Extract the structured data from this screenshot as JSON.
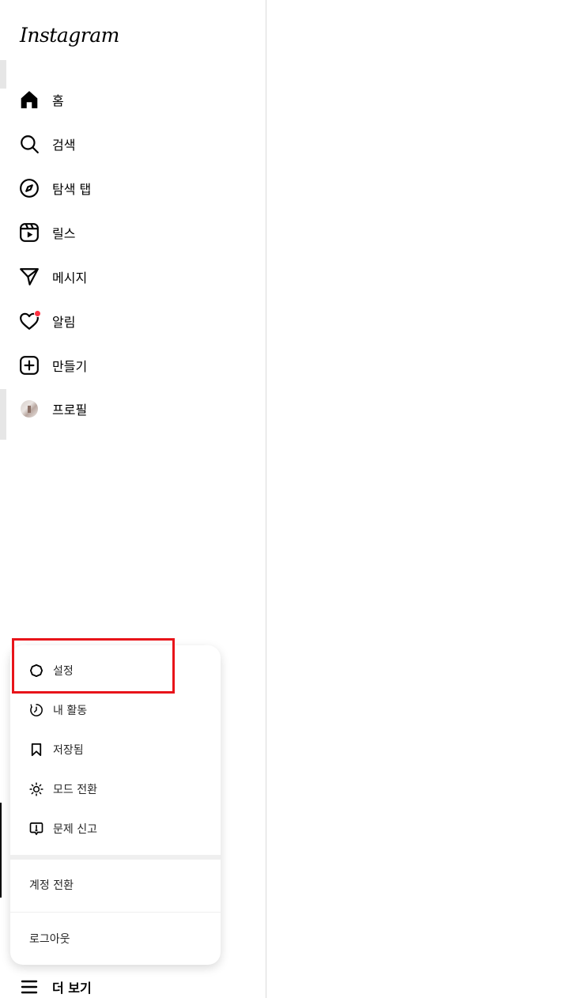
{
  "app": {
    "logo_text": "Instagram"
  },
  "nav": {
    "items": [
      {
        "key": "home",
        "label": "홈",
        "icon": "home-icon"
      },
      {
        "key": "search",
        "label": "검색",
        "icon": "search-icon"
      },
      {
        "key": "explore",
        "label": "탐색 탭",
        "icon": "compass-icon"
      },
      {
        "key": "reels",
        "label": "릴스",
        "icon": "reels-icon"
      },
      {
        "key": "messages",
        "label": "메시지",
        "icon": "send-icon"
      },
      {
        "key": "notifications",
        "label": "알림",
        "icon": "heart-icon"
      },
      {
        "key": "create",
        "label": "만들기",
        "icon": "plus-square-icon"
      },
      {
        "key": "profile",
        "label": "프로필",
        "icon": "avatar"
      }
    ],
    "more_label": "더 보기"
  },
  "more_menu": {
    "items": [
      {
        "key": "settings",
        "label": "설정",
        "icon": "gear-icon"
      },
      {
        "key": "activity",
        "label": "내 활동",
        "icon": "activity-icon"
      },
      {
        "key": "saved",
        "label": "저장됨",
        "icon": "bookmark-icon"
      },
      {
        "key": "mode",
        "label": "모드 전환",
        "icon": "sun-icon"
      },
      {
        "key": "report",
        "label": "문제 신고",
        "icon": "report-icon"
      }
    ],
    "switch_account_label": "계정 전환",
    "logout_label": "로그아웃"
  },
  "colors": {
    "notification_dot": "#ff3040",
    "highlight": "#e8141a",
    "divider": "#dbdbdb"
  }
}
